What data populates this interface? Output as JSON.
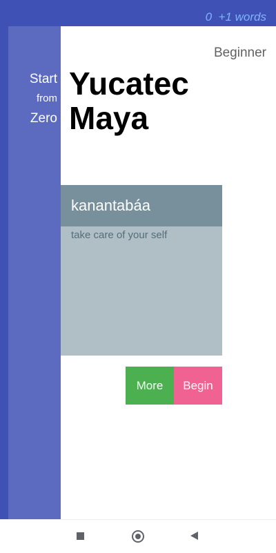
{
  "status": {
    "word_count": "0  +1 words"
  },
  "sidebar": {
    "start": "Start",
    "from": "from",
    "zero": "Zero"
  },
  "header": {
    "level": "Beginner",
    "title": "Yucatec Maya"
  },
  "card": {
    "word": "kanantabáa",
    "meaning": "take care of your self"
  },
  "buttons": {
    "more": "More",
    "begin": "Begin"
  },
  "colors": {
    "frame": "#3f51b5",
    "sidebar": "#5c6bc0",
    "word_count": "#82b1ff",
    "card_header": "#78909c",
    "card_body": "#b0bec5",
    "more": "#4caf50",
    "begin": "#f06292"
  },
  "nav": {
    "icons": [
      "recent-apps-icon",
      "home-icon",
      "back-icon"
    ]
  }
}
